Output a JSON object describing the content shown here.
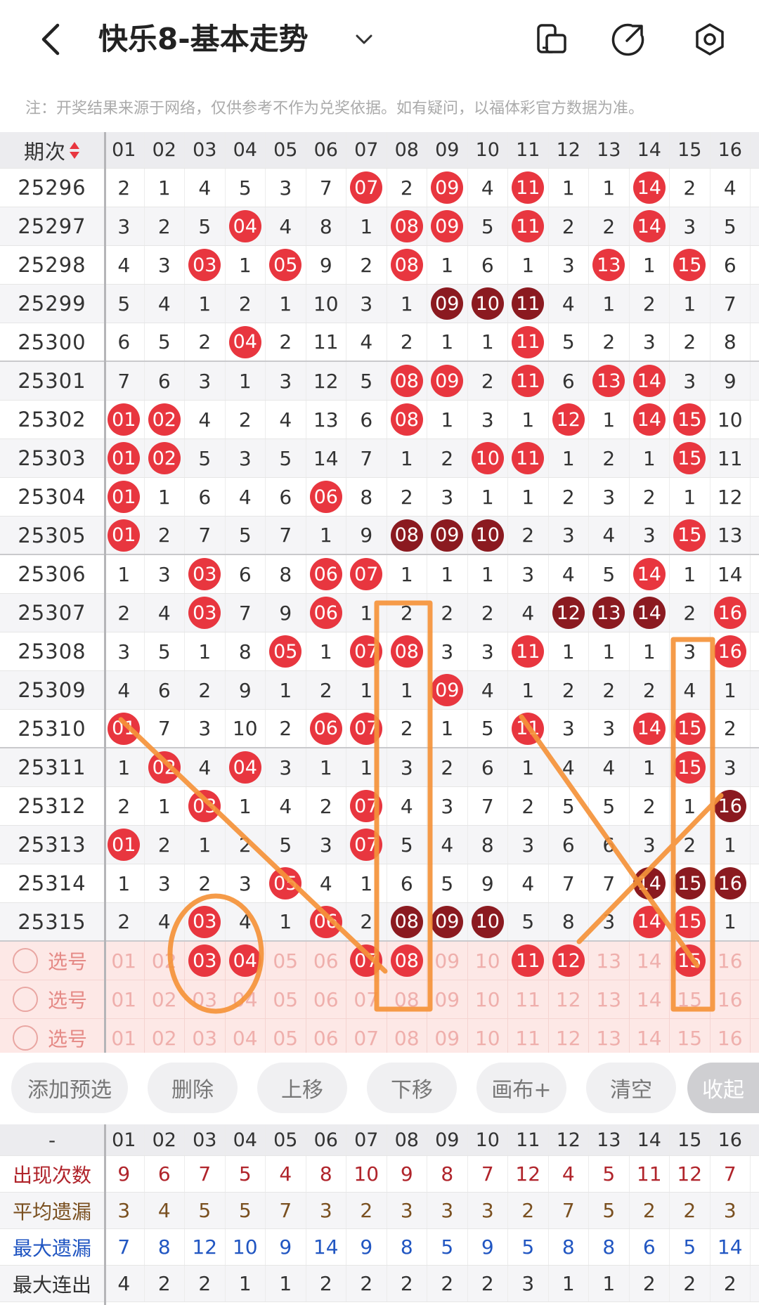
{
  "header": {
    "title": "快乐8-基本走势"
  },
  "notice": "注：开奖结果来源于网络，仅供参考不作为兑奖依据。如有疑问，以福体彩官方数据为准。",
  "table_header": {
    "period_label": "期次",
    "columns": [
      "01",
      "02",
      "03",
      "04",
      "05",
      "06",
      "07",
      "08",
      "09",
      "10",
      "11",
      "12",
      "13",
      "14",
      "15",
      "16"
    ]
  },
  "rows": [
    {
      "period": "25296",
      "cells": [
        "2",
        "1",
        "4",
        "5",
        "3",
        "7",
        "07",
        "2",
        "09",
        "4",
        "11",
        "1",
        "1",
        "14",
        "2",
        "4"
      ],
      "styles": [
        "",
        "",
        "",
        "",
        "",
        "",
        "r",
        "",
        "r",
        "",
        "r",
        "",
        "",
        "r",
        "",
        ""
      ]
    },
    {
      "period": "25297",
      "cells": [
        "3",
        "2",
        "5",
        "04",
        "4",
        "8",
        "1",
        "08",
        "09",
        "5",
        "11",
        "2",
        "2",
        "14",
        "3",
        "5"
      ],
      "styles": [
        "",
        "",
        "",
        "r",
        "",
        "",
        "",
        "r",
        "r",
        "",
        "r",
        "",
        "",
        "r",
        "",
        ""
      ]
    },
    {
      "period": "25298",
      "cells": [
        "4",
        "3",
        "03",
        "1",
        "05",
        "9",
        "2",
        "08",
        "1",
        "6",
        "1",
        "3",
        "13",
        "1",
        "15",
        "6"
      ],
      "styles": [
        "",
        "",
        "r",
        "",
        "r",
        "",
        "",
        "r",
        "",
        "",
        "",
        "",
        "r",
        "",
        "r",
        ""
      ]
    },
    {
      "period": "25299",
      "cells": [
        "5",
        "4",
        "1",
        "2",
        "1",
        "10",
        "3",
        "1",
        "09",
        "10",
        "11",
        "4",
        "1",
        "2",
        "1",
        "7"
      ],
      "styles": [
        "",
        "",
        "",
        "",
        "",
        "",
        "",
        "",
        "d",
        "d",
        "d",
        "",
        "",
        "",
        "",
        ""
      ]
    },
    {
      "period": "25300",
      "cells": [
        "6",
        "5",
        "2",
        "04",
        "2",
        "11",
        "4",
        "2",
        "1",
        "1",
        "11",
        "5",
        "2",
        "3",
        "2",
        "8"
      ],
      "styles": [
        "",
        "",
        "",
        "r",
        "",
        "",
        "",
        "",
        "",
        "",
        "r",
        "",
        "",
        "",
        "",
        ""
      ]
    },
    {
      "period": "25301",
      "cells": [
        "7",
        "6",
        "3",
        "1",
        "3",
        "12",
        "5",
        "08",
        "09",
        "2",
        "11",
        "6",
        "13",
        "14",
        "3",
        "9"
      ],
      "styles": [
        "",
        "",
        "",
        "",
        "",
        "",
        "",
        "r",
        "r",
        "",
        "r",
        "",
        "r",
        "r",
        "",
        ""
      ]
    },
    {
      "period": "25302",
      "cells": [
        "01",
        "02",
        "4",
        "2",
        "4",
        "13",
        "6",
        "08",
        "1",
        "3",
        "1",
        "12",
        "1",
        "14",
        "15",
        "10"
      ],
      "styles": [
        "r",
        "r",
        "",
        "",
        "",
        "",
        "",
        "r",
        "",
        "",
        "",
        "r",
        "",
        "r",
        "r",
        ""
      ]
    },
    {
      "period": "25303",
      "cells": [
        "01",
        "02",
        "5",
        "3",
        "5",
        "14",
        "7",
        "1",
        "2",
        "10",
        "11",
        "1",
        "2",
        "1",
        "15",
        "11"
      ],
      "styles": [
        "r",
        "r",
        "",
        "",
        "",
        "",
        "",
        "",
        "",
        "r",
        "r",
        "",
        "",
        "",
        "r",
        ""
      ]
    },
    {
      "period": "25304",
      "cells": [
        "01",
        "1",
        "6",
        "4",
        "6",
        "06",
        "8",
        "2",
        "3",
        "1",
        "1",
        "2",
        "3",
        "2",
        "1",
        "12"
      ],
      "styles": [
        "r",
        "",
        "",
        "",
        "",
        "r",
        "",
        "",
        "",
        "",
        "",
        "",
        "",
        "",
        "",
        ""
      ]
    },
    {
      "period": "25305",
      "cells": [
        "01",
        "2",
        "7",
        "5",
        "7",
        "1",
        "9",
        "08",
        "09",
        "10",
        "2",
        "3",
        "4",
        "3",
        "15",
        "13"
      ],
      "styles": [
        "r",
        "",
        "",
        "",
        "",
        "",
        "",
        "d",
        "d",
        "d",
        "",
        "",
        "",
        "",
        "r",
        ""
      ]
    },
    {
      "period": "25306",
      "cells": [
        "1",
        "3",
        "03",
        "6",
        "8",
        "06",
        "07",
        "1",
        "1",
        "1",
        "3",
        "4",
        "5",
        "14",
        "1",
        "14"
      ],
      "styles": [
        "",
        "",
        "r",
        "",
        "",
        "r",
        "r",
        "",
        "",
        "",
        "",
        "",
        "",
        "r",
        "",
        ""
      ]
    },
    {
      "period": "25307",
      "cells": [
        "2",
        "4",
        "03",
        "7",
        "9",
        "06",
        "1",
        "2",
        "2",
        "2",
        "4",
        "12",
        "13",
        "14",
        "2",
        "16"
      ],
      "styles": [
        "",
        "",
        "r",
        "",
        "",
        "r",
        "",
        "",
        "",
        "",
        "",
        "d",
        "d",
        "d",
        "",
        "r"
      ]
    },
    {
      "period": "25308",
      "cells": [
        "3",
        "5",
        "1",
        "8",
        "05",
        "1",
        "07",
        "08",
        "3",
        "3",
        "11",
        "1",
        "1",
        "1",
        "3",
        "16"
      ],
      "styles": [
        "",
        "",
        "",
        "",
        "r",
        "",
        "r",
        "r",
        "",
        "",
        "r",
        "",
        "",
        "",
        "",
        "r"
      ]
    },
    {
      "period": "25309",
      "cells": [
        "4",
        "6",
        "2",
        "9",
        "1",
        "2",
        "1",
        "1",
        "09",
        "4",
        "1",
        "2",
        "2",
        "2",
        "4",
        "1"
      ],
      "styles": [
        "",
        "",
        "",
        "",
        "",
        "",
        "",
        "",
        "r",
        "",
        "",
        "",
        "",
        "",
        "",
        ""
      ]
    },
    {
      "period": "25310",
      "cells": [
        "01",
        "7",
        "3",
        "10",
        "2",
        "06",
        "07",
        "2",
        "1",
        "5",
        "11",
        "3",
        "3",
        "14",
        "15",
        "2"
      ],
      "styles": [
        "r",
        "",
        "",
        "",
        "",
        "r",
        "r",
        "",
        "",
        "",
        "r",
        "",
        "",
        "r",
        "r",
        ""
      ]
    },
    {
      "period": "25311",
      "cells": [
        "1",
        "02",
        "4",
        "04",
        "3",
        "1",
        "1",
        "3",
        "2",
        "6",
        "1",
        "4",
        "4",
        "1",
        "15",
        "3"
      ],
      "styles": [
        "",
        "r",
        "",
        "r",
        "",
        "",
        "",
        "",
        "",
        "",
        "",
        "",
        "",
        "",
        "r",
        ""
      ]
    },
    {
      "period": "25312",
      "cells": [
        "2",
        "1",
        "03",
        "1",
        "4",
        "2",
        "07",
        "4",
        "3",
        "7",
        "2",
        "5",
        "5",
        "2",
        "1",
        "16"
      ],
      "styles": [
        "",
        "",
        "r",
        "",
        "",
        "",
        "r",
        "",
        "",
        "",
        "",
        "",
        "",
        "",
        "",
        "d"
      ]
    },
    {
      "period": "25313",
      "cells": [
        "01",
        "2",
        "1",
        "2",
        "5",
        "3",
        "07",
        "5",
        "4",
        "8",
        "3",
        "6",
        "6",
        "3",
        "2",
        "1"
      ],
      "styles": [
        "r",
        "",
        "",
        "",
        "",
        "",
        "r",
        "",
        "",
        "",
        "",
        "",
        "",
        "",
        "",
        ""
      ]
    },
    {
      "period": "25314",
      "cells": [
        "1",
        "3",
        "2",
        "3",
        "05",
        "4",
        "1",
        "6",
        "5",
        "9",
        "4",
        "7",
        "7",
        "14",
        "15",
        "16"
      ],
      "styles": [
        "",
        "",
        "",
        "",
        "r",
        "",
        "",
        "",
        "",
        "",
        "",
        "",
        "",
        "d",
        "d",
        "d"
      ]
    },
    {
      "period": "25315",
      "cells": [
        "2",
        "4",
        "03",
        "4",
        "1",
        "06",
        "2",
        "08",
        "09",
        "10",
        "5",
        "8",
        "3",
        "14",
        "15",
        "1"
      ],
      "styles": [
        "",
        "",
        "r",
        "",
        "",
        "r",
        "",
        "d",
        "d",
        "d",
        "",
        "",
        "",
        "r",
        "r",
        ""
      ]
    }
  ],
  "selection_rows": [
    {
      "label": "选号",
      "selected": [
        "03",
        "04",
        "07",
        "08",
        "11",
        "12",
        "15"
      ]
    },
    {
      "label": "选号",
      "selected": []
    },
    {
      "label": "选号",
      "selected": []
    }
  ],
  "toolbar": {
    "add_preselect": "添加预选",
    "delete": "删除",
    "move_up": "上移",
    "move_down": "下移",
    "canvas": "画布+",
    "clear": "清空",
    "collapse": "收起"
  },
  "stats": {
    "header_label": "-",
    "rows": [
      {
        "label": "出现次数",
        "color": "#b0242b",
        "values": [
          "9",
          "6",
          "7",
          "5",
          "4",
          "8",
          "10",
          "9",
          "8",
          "7",
          "12",
          "4",
          "5",
          "11",
          "12",
          "7"
        ]
      },
      {
        "label": "平均遗漏",
        "color": "#7a5020",
        "values": [
          "3",
          "4",
          "5",
          "5",
          "7",
          "3",
          "2",
          "3",
          "3",
          "3",
          "2",
          "7",
          "5",
          "2",
          "2",
          "3"
        ]
      },
      {
        "label": "最大遗漏",
        "color": "#2156c2",
        "values": [
          "7",
          "8",
          "12",
          "10",
          "9",
          "14",
          "9",
          "8",
          "5",
          "9",
          "5",
          "8",
          "8",
          "6",
          "5",
          "14"
        ]
      },
      {
        "label": "最大连出",
        "color": "#333333",
        "values": [
          "4",
          "2",
          "2",
          "1",
          "1",
          "2",
          "2",
          "2",
          "2",
          "2",
          "3",
          "1",
          "1",
          "2",
          "2",
          "2"
        ]
      }
    ]
  },
  "colors": {
    "ball_red": "#e8363f",
    "ball_dark": "#8b1a20",
    "annotation_orange": "#f5933a"
  }
}
